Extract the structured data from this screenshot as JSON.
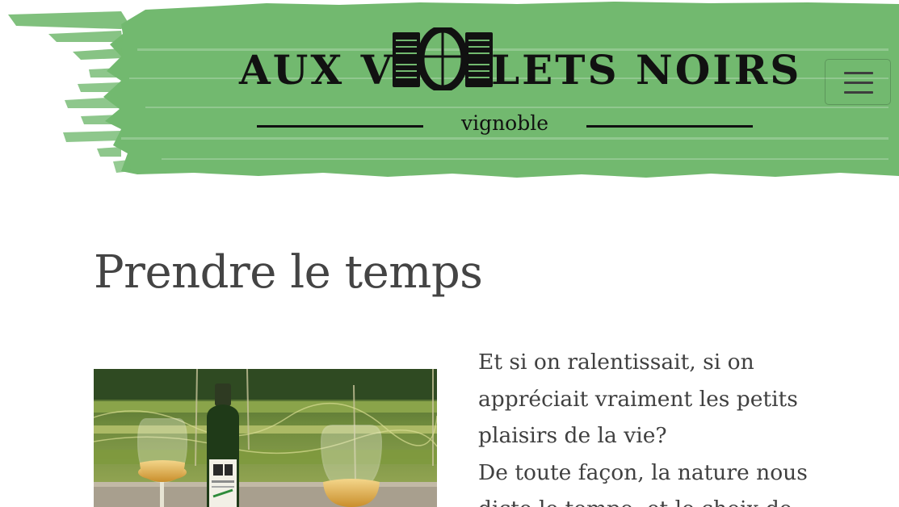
{
  "header": {
    "logo_left": "AUX V",
    "logo_right": "LETS NOIRS",
    "logo_tagline": "vignoble",
    "brand_color": "#72b96f",
    "menu_icon": "hamburger-icon"
  },
  "main": {
    "title": "Prendre le temps",
    "photo_icon": "wine-photo",
    "paragraph_lines": [
      "Et si on ralentissait, si on",
      "appréciait vraiment les petits",
      "plaisirs de la vie?",
      "De toute façon, la nature nous",
      "dicte le tempo, et le choix de"
    ]
  }
}
